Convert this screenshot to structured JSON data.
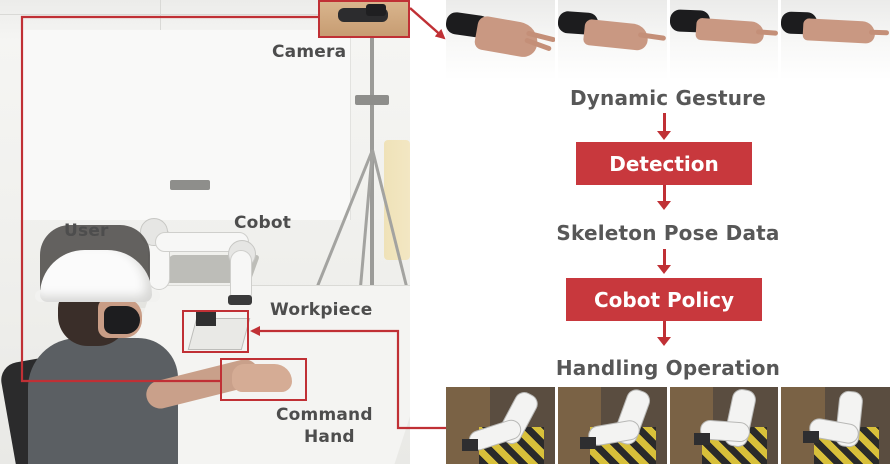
{
  "scene_labels": {
    "camera": "Camera",
    "user": "User",
    "cobot": "Cobot",
    "workpiece": "Workpiece",
    "command_hand_line1": "Command",
    "command_hand_line2": "Hand"
  },
  "pipeline": {
    "step1": "Dynamic Gesture",
    "step2": "Detection",
    "step3": "Skeleton Pose Data",
    "step4": "Cobot Policy",
    "step5": "Handling Operation"
  },
  "colors": {
    "accent": "#c03035",
    "box_fill": "#c8383d",
    "label_text": "#575757"
  },
  "gesture_frames_count": 4,
  "operation_frames_count": 4
}
